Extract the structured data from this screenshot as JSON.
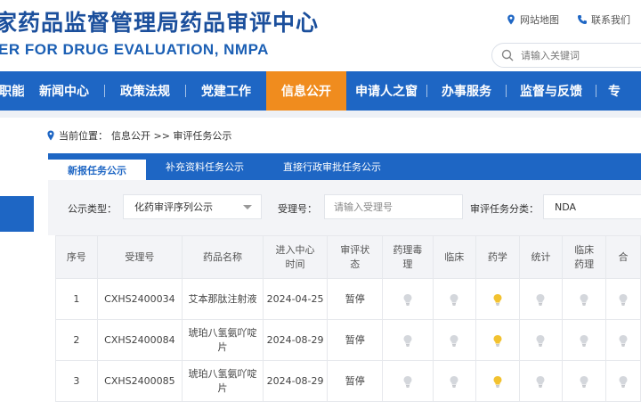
{
  "header": {
    "title": "家药品监督管理局药品审评中心",
    "subtitle": "ER FOR DRUG EVALUATION, NMPA",
    "links": [
      {
        "label": "网站地图",
        "icon": "location-pin-icon"
      },
      {
        "label": "联系我们",
        "icon": "phone-icon"
      }
    ],
    "search": {
      "placeholder": "请输入关键词",
      "icon": "search-icon"
    }
  },
  "nav": {
    "items": [
      {
        "label": "职能"
      },
      {
        "label": "新闻中心"
      },
      {
        "label": "政策法规"
      },
      {
        "label": "党建工作"
      },
      {
        "label": "信息公开",
        "active": true
      },
      {
        "label": "申请人之窗"
      },
      {
        "label": "办事服务"
      },
      {
        "label": "监督与反馈"
      },
      {
        "label": "专"
      }
    ]
  },
  "breadcrumb": {
    "prefix": "当前位置：",
    "path": "信息公开 >> 审评任务公示",
    "icon": "location-pin-icon"
  },
  "tabs": [
    {
      "label": "新报任务公示",
      "active": true
    },
    {
      "label": "补充资料任务公示"
    },
    {
      "label": "直接行政审批任务公示"
    }
  ],
  "filters": {
    "type_label": "公示类型：",
    "type_value": "化药审评序列公示",
    "acceptance_label": "受理号：",
    "acceptance_placeholder": "请输入受理号",
    "category_label": "审评任务分类：",
    "category_value": "NDA"
  },
  "table": {
    "columns": [
      "序号",
      "受理号",
      "药品名称",
      "进入中心\n时间",
      "审评状\n态",
      "药理毒\n理",
      "临床",
      "药学",
      "统计",
      "临床\n药理",
      "合"
    ],
    "rows": [
      {
        "no": "1",
        "acceptance": "CXHS2400034",
        "drug": "艾本那肽注射液",
        "date": "2024-04-25",
        "status": "暂停",
        "lights": [
          false,
          false,
          true,
          false,
          false,
          false
        ]
      },
      {
        "no": "2",
        "acceptance": "CXHS2400084",
        "drug": "琥珀八氢氨吖啶片",
        "date": "2024-08-29",
        "status": "暂停",
        "lights": [
          false,
          false,
          true,
          false,
          false,
          false
        ]
      },
      {
        "no": "3",
        "acceptance": "CXHS2400085",
        "drug": "琥珀八氢氨吖啶片",
        "date": "2024-08-29",
        "status": "暂停",
        "lights": [
          false,
          false,
          true,
          false,
          false,
          false
        ]
      }
    ]
  },
  "colors": {
    "primary": "#1e66c4",
    "nav_active": "#f08c1e",
    "bulb_on": "#f2c230",
    "bulb_off": "#d4d7dc"
  }
}
